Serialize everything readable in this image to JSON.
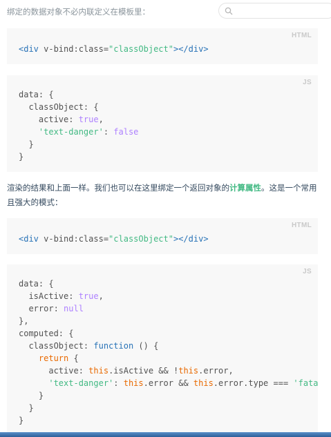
{
  "header": {
    "intro_text": "绑定的数据对象不必内联定义在模板里：",
    "search_placeholder": ""
  },
  "blocks": {
    "html1": {
      "lang": "HTML",
      "lines": [
        [
          [
            "t-tag",
            "<div "
          ],
          [
            "",
            "v-bind:class="
          ],
          [
            "t-str",
            "\"classObject\""
          ],
          [
            "t-tag",
            "></div>"
          ]
        ]
      ]
    },
    "js1": {
      "lang": "JS",
      "lines": [
        [
          [
            "",
            "data: {"
          ]
        ],
        [
          [
            "",
            "  classObject: {"
          ]
        ],
        [
          [
            "",
            "    active: "
          ],
          [
            "t-kw",
            "true"
          ],
          [
            "",
            ","
          ]
        ],
        [
          [
            "t-str",
            "    'text-danger'"
          ],
          [
            "",
            ": "
          ],
          [
            "t-kw",
            "false"
          ]
        ],
        [
          [
            "",
            "  }"
          ]
        ],
        [
          [
            "",
            "}"
          ]
        ]
      ]
    },
    "html2": {
      "lang": "HTML",
      "lines": [
        [
          [
            "t-tag",
            "<div "
          ],
          [
            "",
            "v-bind:class="
          ],
          [
            "t-str",
            "\"classObject\""
          ],
          [
            "t-tag",
            "></div>"
          ]
        ]
      ]
    },
    "js2": {
      "lang": "JS",
      "lines": [
        [
          [
            "",
            "data: {"
          ]
        ],
        [
          [
            "",
            "  isActive: "
          ],
          [
            "t-kw",
            "true"
          ],
          [
            "",
            ","
          ]
        ],
        [
          [
            "",
            "  error: "
          ],
          [
            "t-kw",
            "null"
          ]
        ],
        [
          [
            "",
            "},"
          ]
        ],
        [
          [
            "",
            "computed: {"
          ]
        ],
        [
          [
            "",
            "  classObject: "
          ],
          [
            "t-fn",
            "function"
          ],
          [
            "",
            " () {"
          ]
        ],
        [
          [
            "t-ret",
            "    return"
          ],
          [
            "",
            " {"
          ]
        ],
        [
          [
            "",
            "      active: "
          ],
          [
            "t-this",
            "this"
          ],
          [
            "",
            ".isActive && !"
          ],
          [
            "t-this",
            "this"
          ],
          [
            "",
            ".error,"
          ]
        ],
        [
          [
            "t-str",
            "      'text-danger'"
          ],
          [
            "",
            ": "
          ],
          [
            "t-this",
            "this"
          ],
          [
            "",
            ".error && "
          ],
          [
            "t-this",
            "this"
          ],
          [
            "",
            ".error.type === "
          ],
          [
            "t-str",
            "'fatal'"
          ]
        ],
        [
          [
            "",
            "    }"
          ]
        ],
        [
          [
            "",
            "  }"
          ]
        ],
        [
          [
            "",
            "}"
          ]
        ]
      ]
    }
  },
  "paragraph": {
    "before": "渲染的结果和上面一样。我们也可以在这里绑定一个返回对象的",
    "link": "计算属性",
    "after": "。这是一个常用且强大的模式："
  }
}
